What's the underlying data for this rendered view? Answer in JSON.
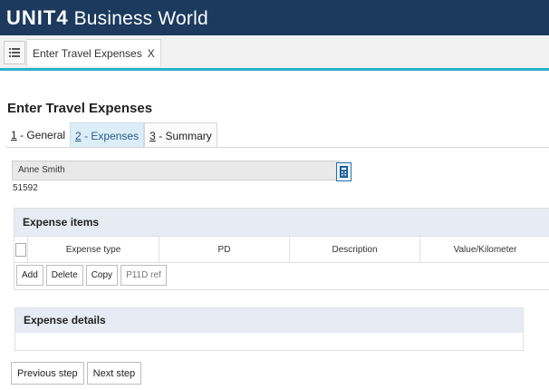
{
  "app": {
    "logo": "UNIT4",
    "product": "Business World"
  },
  "tabs": [
    {
      "label": "Enter Travel Expenses",
      "close": "X"
    }
  ],
  "page": {
    "title": "Enter Travel Expenses"
  },
  "steps": [
    {
      "key": "1",
      "label": " - General"
    },
    {
      "key": "2",
      "label": " - Expenses"
    },
    {
      "key": "3",
      "label": " - Summary"
    }
  ],
  "employee": {
    "name": "Anne Smith",
    "id": "51592"
  },
  "expense_items": {
    "title": "Expense items",
    "columns": [
      "Expense type",
      "PD",
      "Description",
      "Value/Kilometer"
    ],
    "buttons": [
      "Add",
      "Delete",
      "Copy",
      "P11D ref"
    ]
  },
  "expense_details": {
    "title": "Expense details"
  },
  "navigation": {
    "previous": "Previous step",
    "next": "Next step"
  },
  "colors": {
    "topbar": "#1b3a5e",
    "accent": "#2bb0c9",
    "panel_header": "#e7ebf3",
    "active_step": "#dbeef8"
  }
}
